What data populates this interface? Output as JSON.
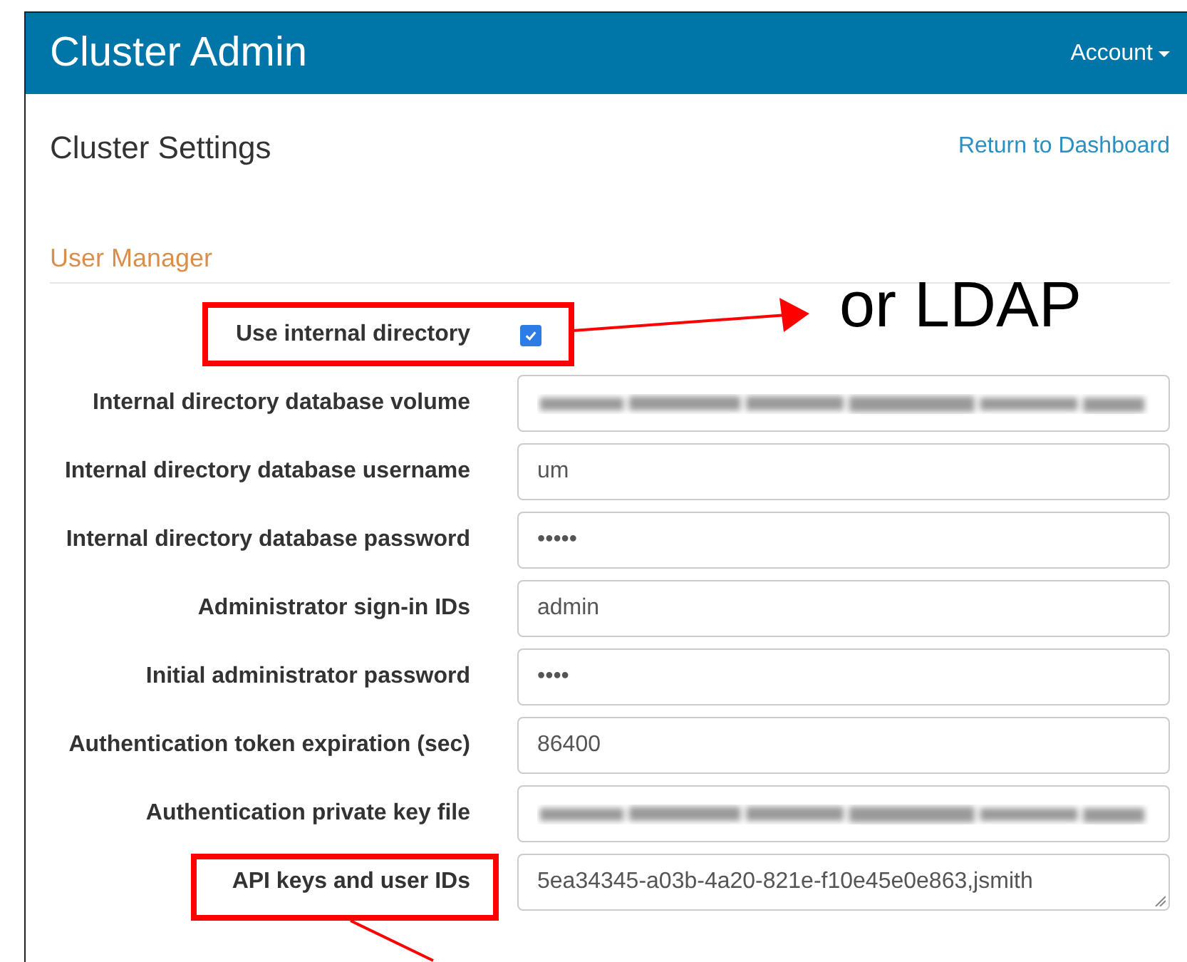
{
  "header": {
    "title": "Cluster Admin",
    "account_menu": "Account"
  },
  "page": {
    "title": "Cluster Settings",
    "back_link": "Return to Dashboard"
  },
  "section": {
    "title": "User Manager",
    "fields": [
      {
        "kind": "checkbox",
        "label": "Use internal directory",
        "checked": true,
        "highlighted": true
      },
      {
        "kind": "blurred",
        "label": "Internal directory database volume",
        "highlighted": false
      },
      {
        "kind": "text",
        "label": "Internal directory database username",
        "value": "um",
        "highlighted": false
      },
      {
        "kind": "text",
        "label": "Internal directory database password",
        "value": "•••••",
        "highlighted": false
      },
      {
        "kind": "text",
        "label": "Administrator sign-in IDs",
        "value": "admin",
        "highlighted": false
      },
      {
        "kind": "text",
        "label": "Initial administrator password",
        "value": "••••",
        "highlighted": false
      },
      {
        "kind": "text",
        "label": "Authentication token expiration (sec)",
        "value": "86400",
        "highlighted": false
      },
      {
        "kind": "blurred",
        "label": "Authentication private key file",
        "highlighted": false
      },
      {
        "kind": "textarea",
        "label": "API keys and user IDs",
        "value": "5ea34345-a03b-4a20-821e-f10e45e0e863,jsmith",
        "highlighted": true
      }
    ]
  },
  "annotation": {
    "callout": "or LDAP"
  }
}
